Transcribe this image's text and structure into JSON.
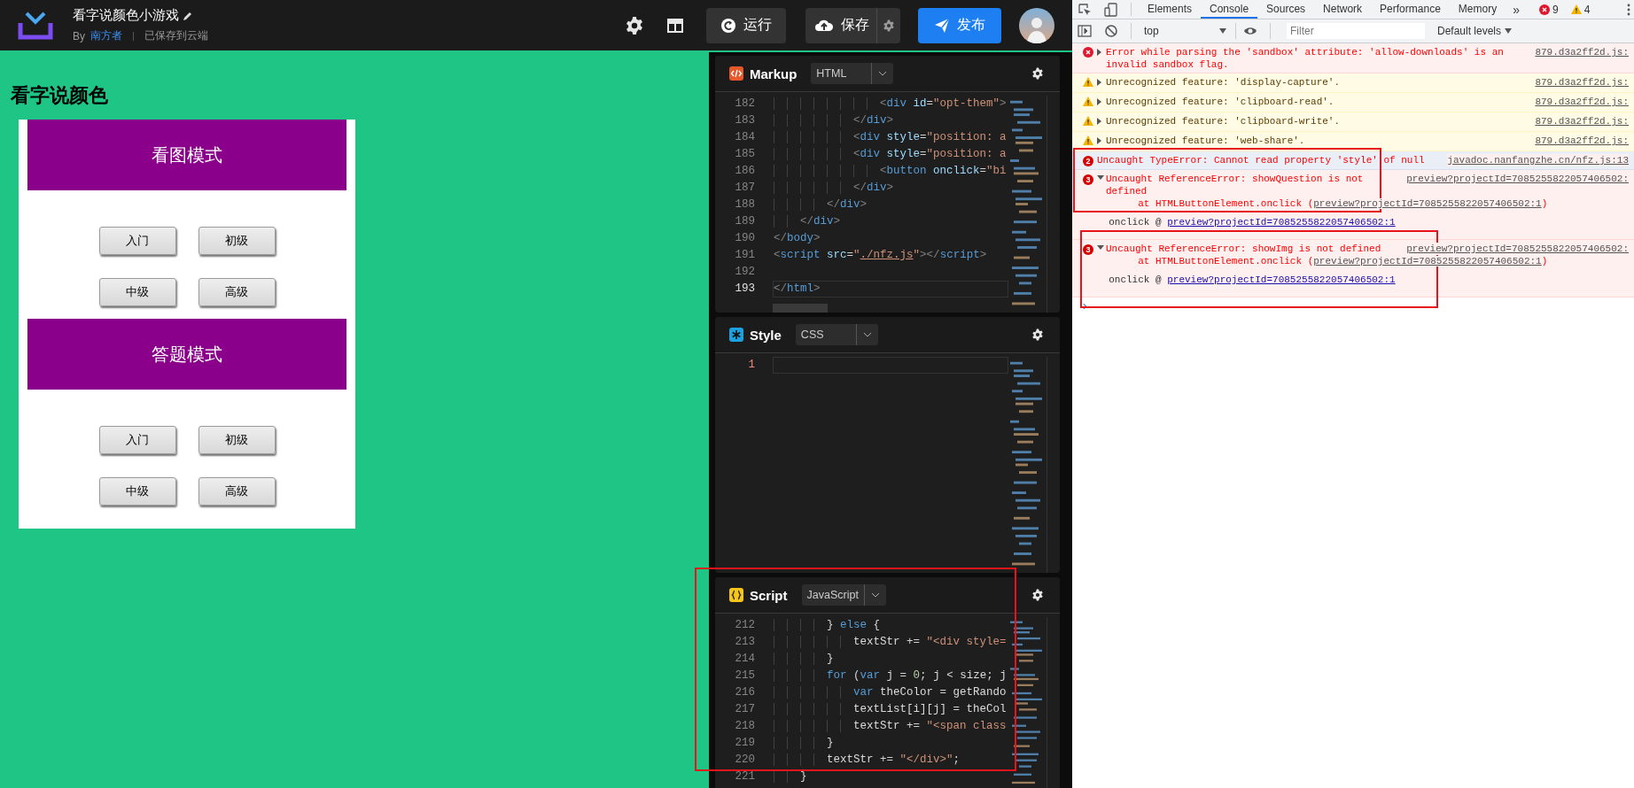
{
  "app_header": {
    "title": "看字说颜色小游戏",
    "by": "By",
    "author": "南方者",
    "save_status": "已保存到云端",
    "run_button": "运行",
    "save_button": "保存",
    "publish_button": "发布"
  },
  "preview": {
    "heading": "看字说颜色",
    "sections": [
      {
        "title": "看图模式",
        "buttons": [
          "入门",
          "初级",
          "中级",
          "高级"
        ]
      },
      {
        "title": "答题模式",
        "buttons": [
          "入门",
          "初级",
          "中级",
          "高级"
        ]
      }
    ]
  },
  "editors": [
    {
      "kind": "markup",
      "title": "Markup",
      "language": "HTML",
      "lines": [
        {
          "number": "182",
          "current": false,
          "tokens": [
            {
              "kind": "punct",
              "text": "                <"
            },
            {
              "kind": "tag",
              "text": "div"
            },
            {
              "kind": "attr",
              "text": " id"
            },
            {
              "kind": "op",
              "text": "="
            },
            {
              "kind": "str",
              "text": "\"opt-them\""
            },
            {
              "kind": "punct",
              "text": ">"
            }
          ]
        },
        {
          "number": "183",
          "current": false,
          "tokens": [
            {
              "kind": "punct",
              "text": "            </"
            },
            {
              "kind": "tag",
              "text": "div"
            },
            {
              "kind": "punct",
              "text": ">"
            }
          ]
        },
        {
          "number": "184",
          "current": false,
          "tokens": [
            {
              "kind": "punct",
              "text": "            <"
            },
            {
              "kind": "tag",
              "text": "div"
            },
            {
              "kind": "attr",
              "text": " style"
            },
            {
              "kind": "op",
              "text": "="
            },
            {
              "kind": "str",
              "text": "\"position: a"
            }
          ]
        },
        {
          "number": "185",
          "current": false,
          "tokens": [
            {
              "kind": "punct",
              "text": "            <"
            },
            {
              "kind": "tag",
              "text": "div"
            },
            {
              "kind": "attr",
              "text": " style"
            },
            {
              "kind": "op",
              "text": "="
            },
            {
              "kind": "str",
              "text": "\"position: a"
            }
          ]
        },
        {
          "number": "186",
          "current": false,
          "tokens": [
            {
              "kind": "punct",
              "text": "                <"
            },
            {
              "kind": "tag",
              "text": "button"
            },
            {
              "kind": "attr",
              "text": " onclick"
            },
            {
              "kind": "op",
              "text": "="
            },
            {
              "kind": "str",
              "text": "\"bi"
            }
          ]
        },
        {
          "number": "187",
          "current": false,
          "tokens": [
            {
              "kind": "punct",
              "text": "            </"
            },
            {
              "kind": "tag",
              "text": "div"
            },
            {
              "kind": "punct",
              "text": ">"
            }
          ]
        },
        {
          "number": "188",
          "current": false,
          "tokens": [
            {
              "kind": "punct",
              "text": "        </"
            },
            {
              "kind": "tag",
              "text": "div"
            },
            {
              "kind": "punct",
              "text": ">"
            }
          ]
        },
        {
          "number": "189",
          "current": false,
          "tokens": [
            {
              "kind": "punct",
              "text": "    </"
            },
            {
              "kind": "tag",
              "text": "div"
            },
            {
              "kind": "punct",
              "text": ">"
            }
          ]
        },
        {
          "number": "190",
          "current": false,
          "tokens": [
            {
              "kind": "punct",
              "text": "</"
            },
            {
              "kind": "tag",
              "text": "body"
            },
            {
              "kind": "punct",
              "text": ">"
            }
          ]
        },
        {
          "number": "191",
          "current": false,
          "tokens": [
            {
              "kind": "punct",
              "text": "<"
            },
            {
              "kind": "tag",
              "text": "script"
            },
            {
              "kind": "attr",
              "text": " src"
            },
            {
              "kind": "op",
              "text": "="
            },
            {
              "kind": "str",
              "text": "\""
            },
            {
              "kind": "link",
              "text": "./nfz.js"
            },
            {
              "kind": "str",
              "text": "\""
            },
            {
              "kind": "punct",
              "text": "></"
            },
            {
              "kind": "tag",
              "text": "script"
            },
            {
              "kind": "punct",
              "text": ">"
            }
          ]
        },
        {
          "number": "192",
          "current": false
        },
        {
          "number": "193",
          "current": true,
          "tokens": [
            {
              "kind": "punct",
              "text": "</"
            },
            {
              "kind": "tag",
              "text": "html"
            },
            {
              "kind": "punct",
              "text": ">"
            }
          ]
        }
      ]
    },
    {
      "kind": "style",
      "title": "Style",
      "language": "CSS",
      "lines": [
        {
          "number": "1",
          "current": true
        }
      ]
    },
    {
      "kind": "script",
      "title": "Script",
      "language": "JavaScript",
      "lines": [
        {
          "number": "212",
          "current": false,
          "tokens": [
            {
              "kind": "op",
              "text": "        }"
            },
            {
              "kind": "kw",
              "text": " else"
            },
            {
              "kind": "op",
              "text": " {"
            }
          ]
        },
        {
          "number": "213",
          "current": false,
          "tokens": [
            {
              "kind": "id",
              "text": "            textStr"
            },
            {
              "kind": "op",
              "text": " +="
            },
            {
              "kind": "str",
              "text": " \"<div style="
            }
          ]
        },
        {
          "number": "214",
          "current": false,
          "tokens": [
            {
              "kind": "op",
              "text": "        }"
            }
          ]
        },
        {
          "number": "215",
          "current": false,
          "tokens": [
            {
              "kind": "kw",
              "text": "        for"
            },
            {
              "kind": "op",
              "text": " ("
            },
            {
              "kind": "kw",
              "text": "var"
            },
            {
              "kind": "id",
              "text": " j"
            },
            {
              "kind": "op",
              "text": " ="
            },
            {
              "kind": "num",
              "text": " 0"
            },
            {
              "kind": "op",
              "text": ";"
            },
            {
              "kind": "id",
              "text": " j"
            },
            {
              "kind": "op",
              "text": " <"
            },
            {
              "kind": "id",
              "text": " size"
            },
            {
              "kind": "op",
              "text": ";"
            },
            {
              "kind": "id",
              "text": " j"
            }
          ]
        },
        {
          "number": "216",
          "current": false,
          "tokens": [
            {
              "kind": "kw",
              "text": "            var"
            },
            {
              "kind": "id",
              "text": " theColor"
            },
            {
              "kind": "op",
              "text": " ="
            },
            {
              "kind": "id",
              "text": " getRando"
            }
          ]
        },
        {
          "number": "217",
          "current": false,
          "tokens": [
            {
              "kind": "id",
              "text": "            textList[i][j]"
            },
            {
              "kind": "op",
              "text": " ="
            },
            {
              "kind": "id",
              "text": " theCol"
            }
          ]
        },
        {
          "number": "218",
          "current": false,
          "tokens": [
            {
              "kind": "id",
              "text": "            textStr"
            },
            {
              "kind": "op",
              "text": " +="
            },
            {
              "kind": "str",
              "text": " \"<span class"
            }
          ]
        },
        {
          "number": "219",
          "current": false,
          "tokens": [
            {
              "kind": "op",
              "text": "        }"
            }
          ]
        },
        {
          "number": "220",
          "current": false,
          "tokens": [
            {
              "kind": "id",
              "text": "        textStr"
            },
            {
              "kind": "op",
              "text": " +="
            },
            {
              "kind": "str",
              "text": " \"</div>\""
            },
            {
              "kind": "op",
              "text": ";"
            }
          ]
        },
        {
          "number": "221",
          "current": false,
          "tokens": [
            {
              "kind": "op",
              "text": "    }"
            }
          ]
        }
      ]
    }
  ],
  "devtools": {
    "tabs": [
      {
        "label": "Elements",
        "selected": false
      },
      {
        "label": "Console",
        "selected": true
      },
      {
        "label": "Sources",
        "selected": false
      },
      {
        "label": "Network",
        "selected": false
      },
      {
        "label": "Performance",
        "selected": false
      },
      {
        "label": "Memory",
        "selected": false
      }
    ],
    "more": "»",
    "error_count": "9",
    "warning_count": "4",
    "context": "top",
    "filter_placeholder": "Filter",
    "levels": "Default levels",
    "messages": [
      {
        "kind": "error",
        "collapsible": true,
        "expanded": false,
        "highlighted": false,
        "text": "Error while parsing the 'sandbox' attribute: 'allow-downloads' is an invalid sandbox flag.",
        "source": "879.d3a2ff2d.js:"
      },
      {
        "kind": "warning",
        "collapsible": true,
        "expanded": false,
        "highlighted": false,
        "text": "Unrecognized feature: 'display-capture'.",
        "source": "879.d3a2ff2d.js:"
      },
      {
        "kind": "warning",
        "collapsible": true,
        "expanded": false,
        "highlighted": false,
        "text": "Unrecognized feature: 'clipboard-read'.",
        "source": "879.d3a2ff2d.js:"
      },
      {
        "kind": "warning",
        "collapsible": true,
        "expanded": false,
        "highlighted": false,
        "text": "Unrecognized feature: 'clipboard-write'.",
        "source": "879.d3a2ff2d.js:"
      },
      {
        "kind": "warning",
        "collapsible": true,
        "expanded": false,
        "highlighted": false,
        "text": "Unrecognized feature: 'web-share'.",
        "source": "879.d3a2ff2d.js:"
      },
      {
        "kind": "error",
        "count": "2",
        "collapsible": false,
        "expanded": false,
        "highlighted": true,
        "text": "Uncaught TypeError: Cannot read property 'style' of null",
        "source": "javadoc.nanfangzhe.cn/nfz.js:13"
      },
      {
        "kind": "error",
        "count": "3",
        "collapsible": true,
        "expanded": true,
        "highlighted": false,
        "text": "Uncaught ReferenceError: showQuestion is not defined",
        "source": "preview?projectId=7085255822057406502:",
        "stack": [
          {
            "prefix": "at HTMLButtonElement.onclick (",
            "link": "preview?projectId=7085255822057406502:1",
            "suffix": ")"
          }
        ],
        "trace": {
          "label": "onclick @",
          "link": "preview?projectId=7085255822057406502:1"
        }
      },
      {
        "kind": "error",
        "count": "3",
        "collapsible": true,
        "expanded": true,
        "highlighted": false,
        "text": "Uncaught ReferenceError: showImg is not defined",
        "source": "preview?projectId=7085255822057406502:",
        "stack": [
          {
            "prefix": "at HTMLButtonElement.onclick (",
            "link": "preview?projectId=7085255822057406502:1",
            "suffix": ")"
          }
        ],
        "trace": {
          "label": "onclick @",
          "link": "preview?projectId=7085255822057406502:1"
        }
      }
    ],
    "prompt": "›"
  },
  "annotation_frames": [
    {
      "kind": "rectangle"
    },
    {
      "kind": "rectangle"
    },
    {
      "kind": "rectangle"
    }
  ]
}
